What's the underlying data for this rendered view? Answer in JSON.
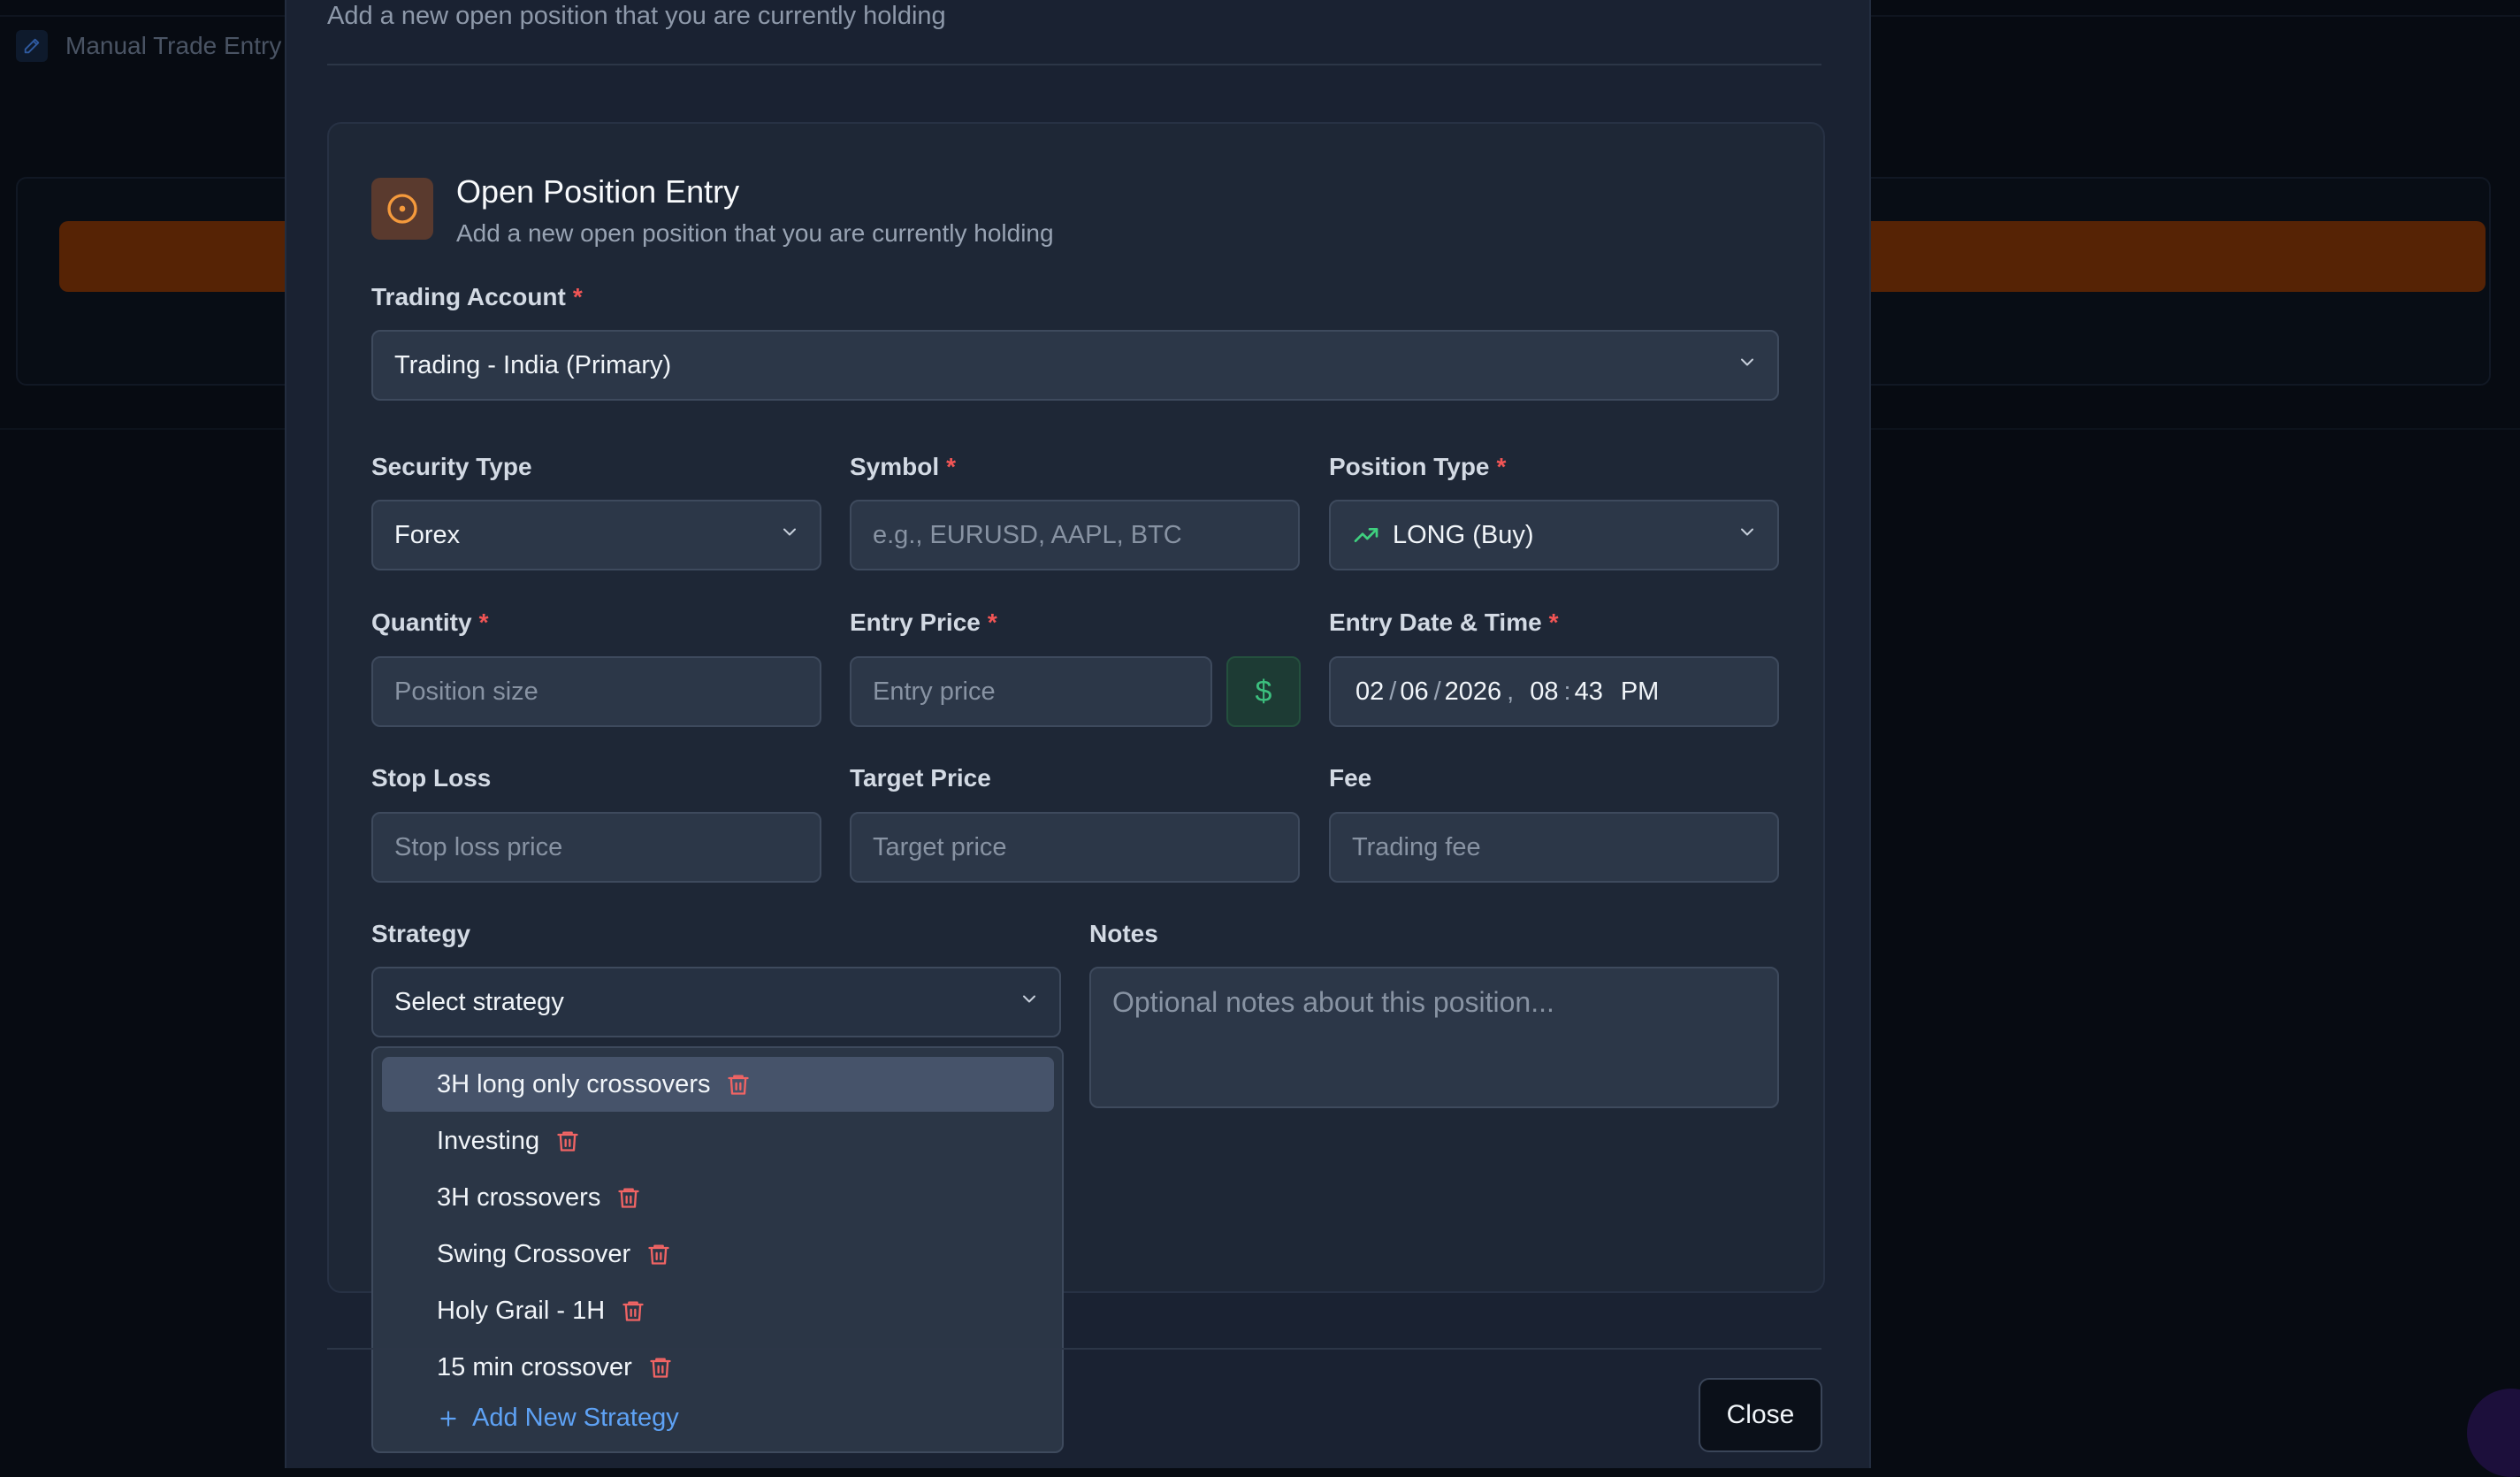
{
  "background": {
    "page_title": "Manual Trade Entry"
  },
  "modal": {
    "description": "Add a new open position that you are currently holding",
    "close_label": "Close"
  },
  "entry": {
    "title": "Open Position Entry",
    "subtitle": "Add a new open position that you are currently holding",
    "icon": "target-icon"
  },
  "form": {
    "trading_account": {
      "label": "Trading Account",
      "required": "*",
      "value": "Trading - India (Primary)"
    },
    "security_type": {
      "label": "Security Type",
      "value": "Forex"
    },
    "symbol": {
      "label": "Symbol",
      "required": "*",
      "placeholder": "e.g., EURUSD, AAPL, BTC"
    },
    "position_type": {
      "label": "Position Type",
      "required": "*",
      "value": "LONG (Buy)",
      "icon": "trending-up-icon",
      "icon_color": "#3fd07f"
    },
    "quantity": {
      "label": "Quantity",
      "required": "*",
      "placeholder": "Position size"
    },
    "entry_price": {
      "label": "Entry Price",
      "required": "*",
      "placeholder": "Entry price",
      "currency_symbol": "$"
    },
    "entry_datetime": {
      "label": "Entry Date & Time",
      "required": "*",
      "month": "02",
      "day": "06",
      "year": "2026",
      "hour": "08",
      "minute": "43",
      "ampm": "PM"
    },
    "stop_loss": {
      "label": "Stop Loss",
      "placeholder": "Stop loss price"
    },
    "target_price": {
      "label": "Target Price",
      "placeholder": "Target price"
    },
    "fee": {
      "label": "Fee",
      "placeholder": "Trading fee"
    },
    "strategy": {
      "label": "Strategy",
      "value": "Select strategy"
    },
    "notes": {
      "label": "Notes",
      "placeholder": "Optional notes about this position..."
    }
  },
  "strategy_dropdown": {
    "options": [
      "3H long only crossovers",
      "Investing",
      "3H crossovers",
      "Swing Crossover",
      "Holy Grail - 1H",
      "15 min crossover"
    ],
    "add_label": "Add New Strategy"
  },
  "colors": {
    "accent_orange": "#f59a3c",
    "required": "#f25555",
    "trash": "#f06464",
    "link": "#5ea2f5",
    "success": "#3cbf7e"
  }
}
